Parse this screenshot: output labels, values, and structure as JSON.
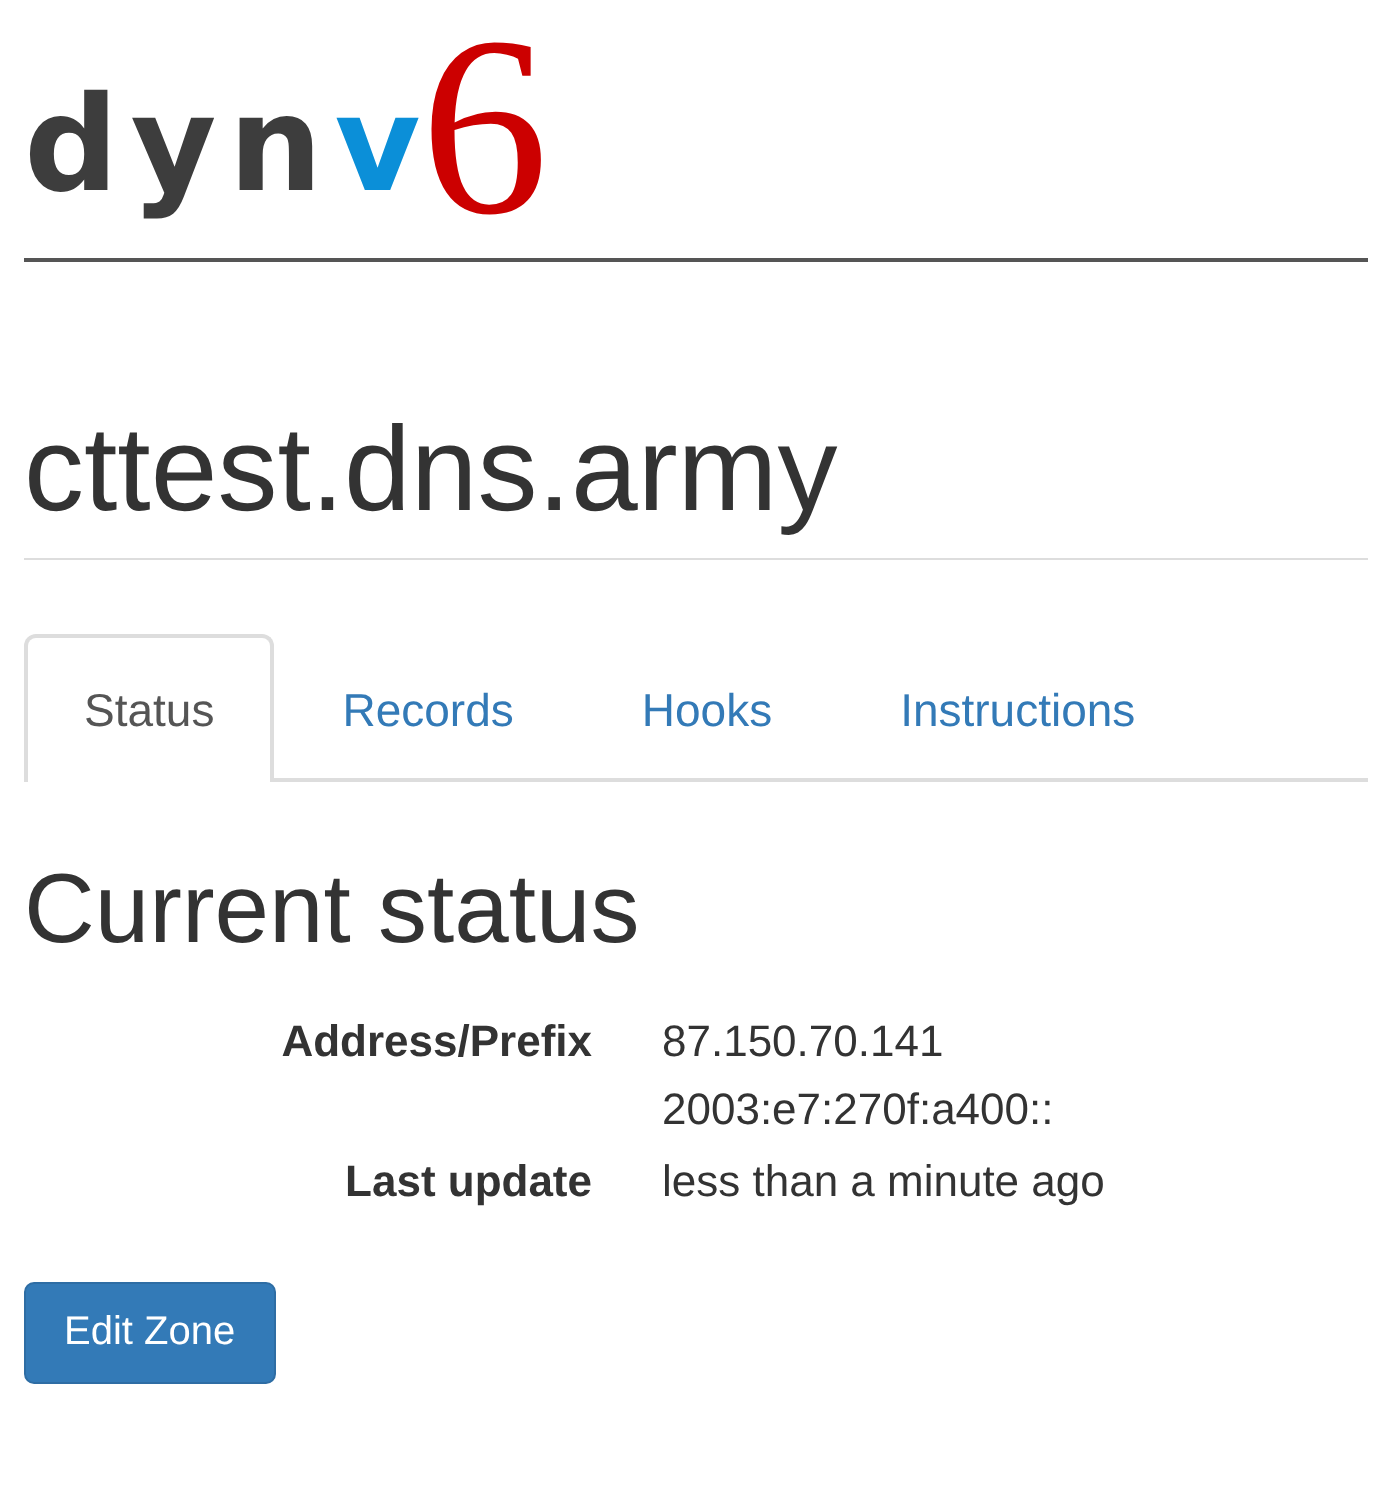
{
  "logo": {
    "parts": [
      {
        "text": "dyn",
        "kind": "base"
      },
      {
        "text": "v",
        "kind": "accent"
      },
      {
        "text": "6",
        "kind": "numeral"
      }
    ]
  },
  "title": "cttest.dns.army",
  "tabs": [
    {
      "label": "Status",
      "selected": true
    },
    {
      "label": "Records",
      "selected": false
    },
    {
      "label": "Hooks",
      "selected": false
    },
    {
      "label": "Instructions",
      "selected": false
    }
  ],
  "heading": "Current status",
  "status": [
    {
      "label": "Address/Prefix",
      "values": [
        "87.150.70.141",
        "2003:e7:270f:a400::"
      ]
    },
    {
      "label": "Last update",
      "values": [
        "less than a minute ago"
      ]
    }
  ],
  "button": "Edit Zone"
}
